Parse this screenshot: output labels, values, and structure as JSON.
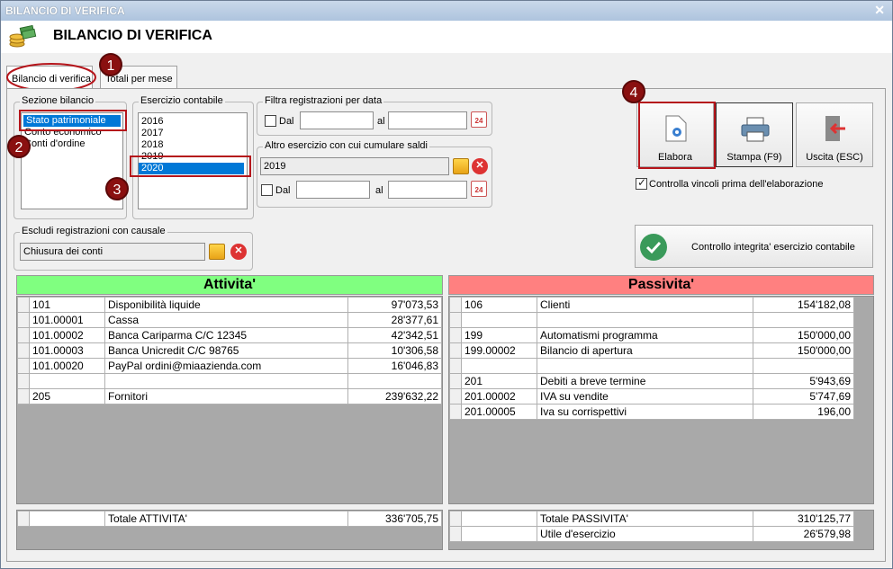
{
  "window": {
    "title": "BILANCIO DI VERIFICA",
    "close_glyph": "✕"
  },
  "header": {
    "title": "BILANCIO DI VERIFICA",
    "icon": "coins-stack-icon"
  },
  "tabs": [
    {
      "label": "Bilancio di verifica",
      "active": true
    },
    {
      "label": "Totali per mese",
      "active": false
    }
  ],
  "sezione_bilancio": {
    "label": "Sezione bilancio",
    "items": [
      "Stato patrimoniale",
      "Conto economico",
      "Conti d'ordine"
    ],
    "selected": "Stato patrimoniale"
  },
  "esercizio_contabile": {
    "label": "Esercizio contabile",
    "items": [
      "2016",
      "2017",
      "2018",
      "2019",
      "2020"
    ],
    "selected": "2020"
  },
  "filtra_data": {
    "label": "Filtra registrazioni per data",
    "dal_label": "Dal",
    "al_label": "al",
    "dal_value": "",
    "al_value": "",
    "dal_checked": false
  },
  "altro_esercizio": {
    "label": "Altro esercizio con cui cumulare saldi",
    "value": "2019",
    "dal_label": "Dal",
    "al_label": "al",
    "dal_value": "",
    "al_value": "",
    "dal_checked": false
  },
  "escludi_causale": {
    "label": "Escludi registrazioni con causale",
    "value": "Chiusura dei conti"
  },
  "buttons": {
    "elabora": "Elabora",
    "stampa": "Stampa (F9)",
    "uscita": "Uscita (ESC)"
  },
  "controlla_vincoli": {
    "label": "Controlla vincoli prima dell'elaborazione",
    "checked": true
  },
  "controllo_integrita": {
    "label": "Controllo integrita' esercizio contabile"
  },
  "markers": [
    "1",
    "2",
    "3",
    "4"
  ],
  "calendar_glyph": "24",
  "delete_glyph": "✕",
  "attivita": {
    "title": "Attivita'",
    "color": "#80ff80",
    "rows": [
      {
        "code": "101",
        "desc": "Disponibilità liquide",
        "amount": "97'073,53"
      },
      {
        "code": "101.00001",
        "desc": "Cassa",
        "amount": "28'377,61"
      },
      {
        "code": "101.00002",
        "desc": "Banca Cariparma C/C 12345",
        "amount": "42'342,51"
      },
      {
        "code": "101.00003",
        "desc": "Banca Unicredit C/C 98765",
        "amount": "10'306,58"
      },
      {
        "code": "101.00020",
        "desc": "PayPal ordini@miaazienda.com",
        "amount": "16'046,83"
      },
      {
        "code": "",
        "desc": "",
        "amount": ""
      },
      {
        "code": "205",
        "desc": "Fornitori",
        "amount": "239'632,22"
      }
    ],
    "totals": [
      {
        "code": "",
        "desc": "Totale ATTIVITA'",
        "amount": "336'705,75"
      }
    ]
  },
  "passivita": {
    "title": "Passivita'",
    "color": "#ff8080",
    "rows": [
      {
        "code": "106",
        "desc": "Clienti",
        "amount": "154'182,08"
      },
      {
        "code": "",
        "desc": "",
        "amount": ""
      },
      {
        "code": "199",
        "desc": "Automatismi programma",
        "amount": "150'000,00"
      },
      {
        "code": "199.00002",
        "desc": "Bilancio di apertura",
        "amount": "150'000,00"
      },
      {
        "code": "",
        "desc": "",
        "amount": ""
      },
      {
        "code": "201",
        "desc": "Debiti a breve termine",
        "amount": "5'943,69"
      },
      {
        "code": "201.00002",
        "desc": "IVA su vendite",
        "amount": "5'747,69"
      },
      {
        "code": "201.00005",
        "desc": "Iva su corrispettivi",
        "amount": "196,00"
      }
    ],
    "totals": [
      {
        "code": "",
        "desc": "Totale PASSIVITA'",
        "amount": "310'125,77"
      },
      {
        "code": "",
        "desc": "Utile d'esercizio",
        "amount": "26'579,98"
      }
    ]
  }
}
